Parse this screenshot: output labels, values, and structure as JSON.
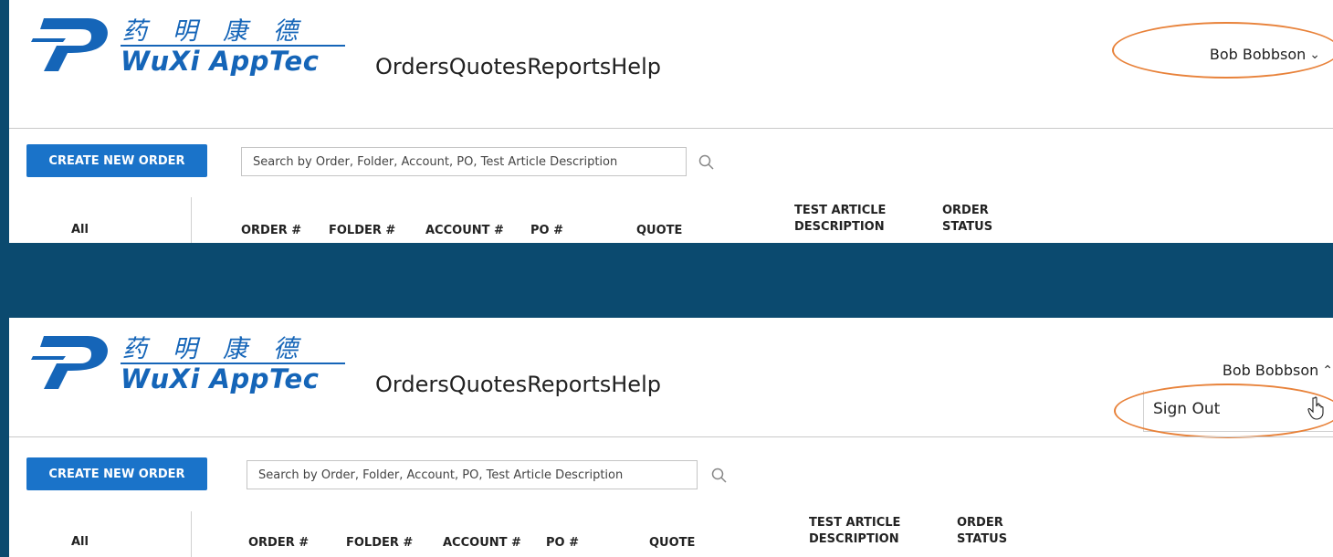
{
  "brand": {
    "chinese_name": "药明康德",
    "english_name": "WuXi AppTec"
  },
  "nav": {
    "orders": "Orders",
    "quotes": "Quotes",
    "reports": "Reports",
    "help": "Help"
  },
  "user": {
    "name": "Bob Bobbson"
  },
  "user_menu": {
    "sign_out": "Sign Out"
  },
  "toolbar": {
    "create_label": "CREATE NEW ORDER",
    "search_placeholder": "Search by Order, Folder, Account, PO, Test Article Description"
  },
  "filter": {
    "all": "All"
  },
  "columns": {
    "order": "ORDER #",
    "folder": "FOLDER #",
    "account": "ACCOUNT #",
    "po": "PO #",
    "quote": "QUOTE",
    "test_article_1": "TEST ARTICLE",
    "test_article_2": "DESCRIPTION",
    "order_status_1": "ORDER",
    "order_status_2": "STATUS"
  },
  "icons": {
    "search": "search-icon",
    "chevron_down": "chevron-down-icon",
    "chevron_up": "chevron-up-icon",
    "pointer": "hand-pointer-icon"
  },
  "colors": {
    "background": "#0b4a6f",
    "brand_blue": "#1565b8",
    "button_blue": "#1a73c9",
    "highlight_orange": "#e8823a"
  }
}
